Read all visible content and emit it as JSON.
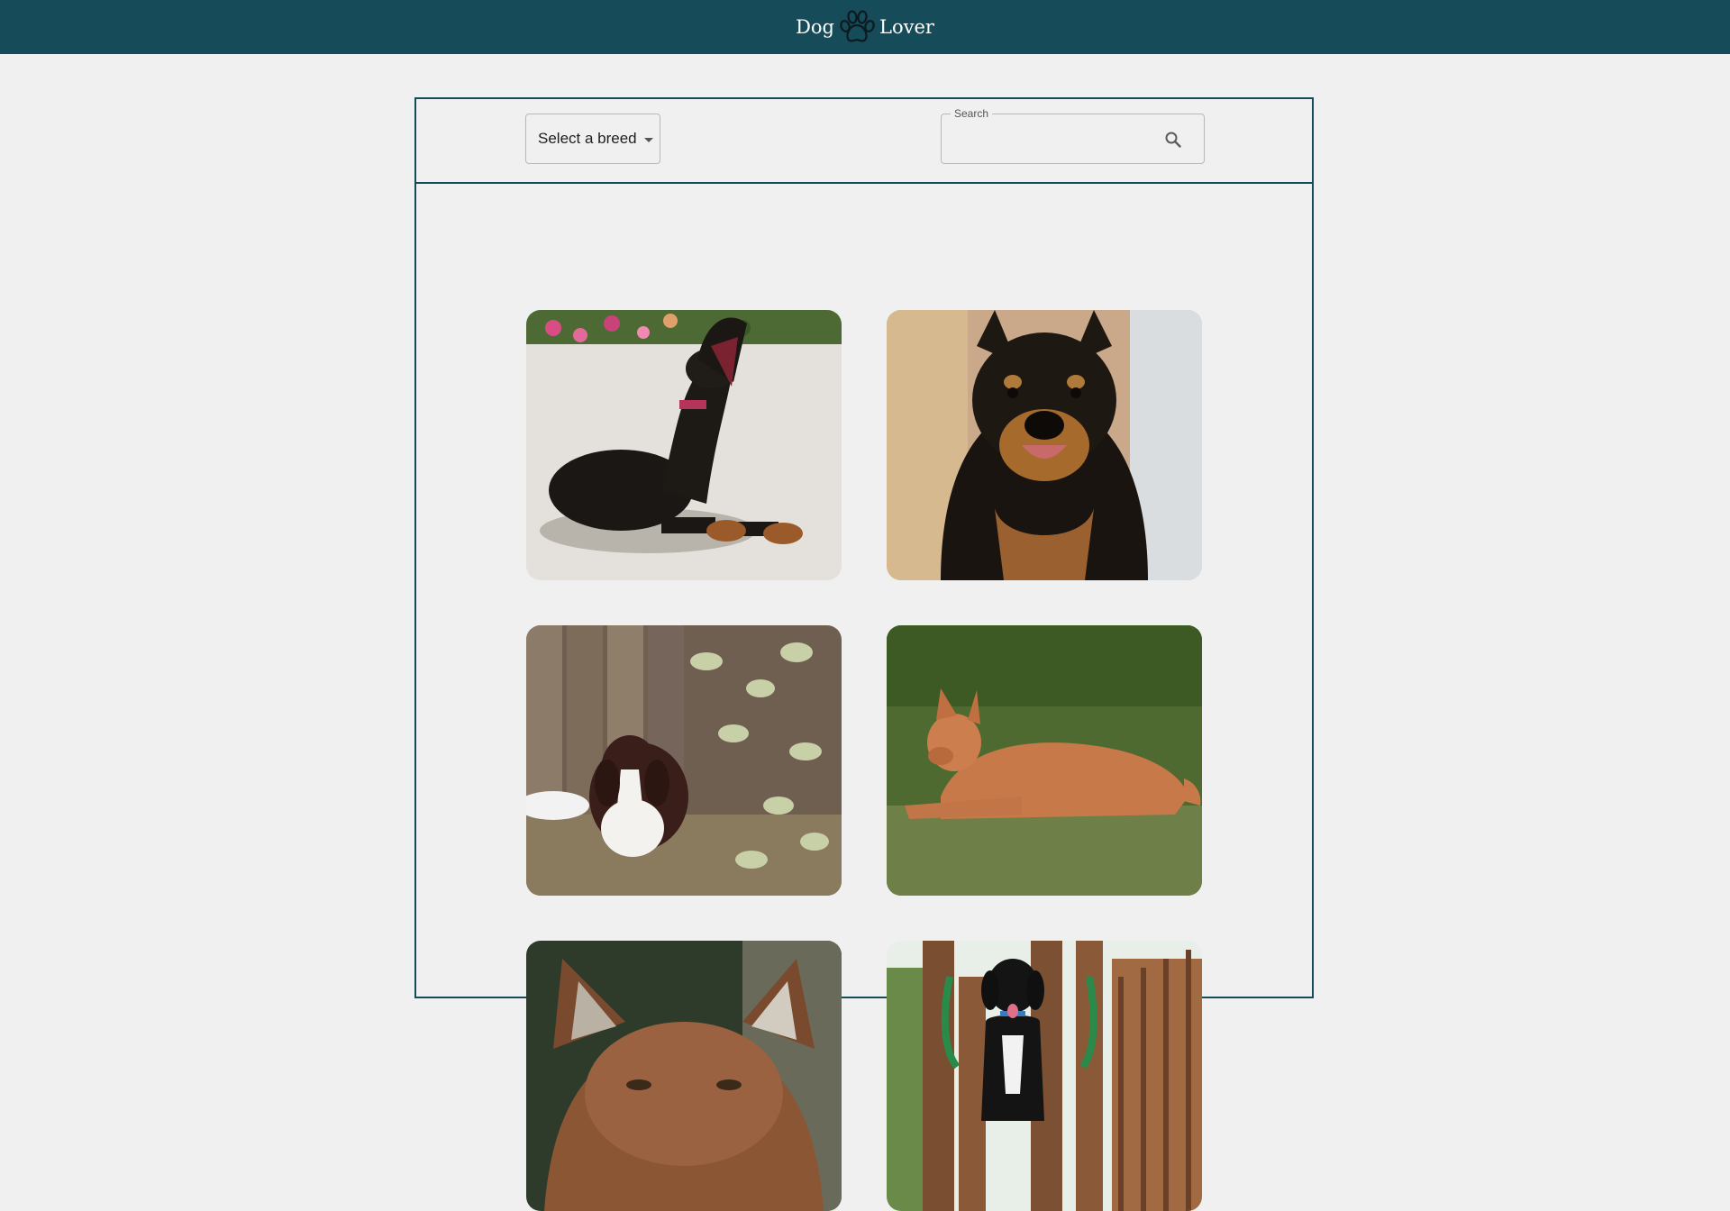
{
  "appbar": {
    "brand_left": "Dog",
    "brand_icon": "paw-icon",
    "brand_right": "Lover",
    "background": "#164c5a"
  },
  "filters": {
    "breed_select": {
      "label": "Select a breed",
      "icon": "caret-down-icon"
    },
    "search": {
      "legend": "Search",
      "value": "",
      "placeholder": "",
      "icon": "search-icon"
    }
  },
  "gallery": {
    "photos": [
      {
        "subject": "doberman-puppy-yawning"
      },
      {
        "subject": "black-and-tan-fluffy-dog"
      },
      {
        "subject": "springer-spaniel-puppy"
      },
      {
        "subject": "red-dog-lying-on-grass"
      },
      {
        "subject": "red-fox-like-dog-closeup"
      },
      {
        "subject": "black-dog-on-wooden-playset"
      }
    ]
  },
  "colors": {
    "accent": "#164c5a",
    "page_background": "#f0f0f0"
  }
}
